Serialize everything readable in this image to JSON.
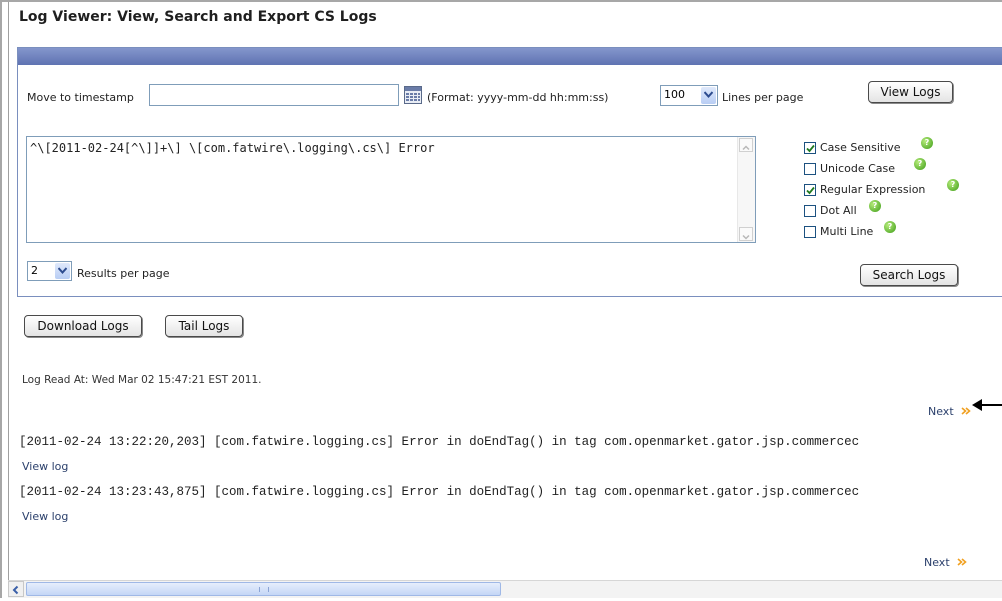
{
  "page": {
    "title": "Log Viewer: View, Search and Export CS Logs"
  },
  "timestamp": {
    "label": "Move to timestamp",
    "value": "",
    "format_hint": "(Format: yyyy-mm-dd hh:mm:ss)"
  },
  "lines_per_page": {
    "value": "100",
    "label": "Lines per page"
  },
  "view_logs_button": "View Logs",
  "search": {
    "query": "^\\[2011-02-24[^\\]]+\\] \\[com.fatwire\\.logging\\.cs\\] Error",
    "options": [
      {
        "label": "Case Sensitive",
        "checked": true
      },
      {
        "label": "Unicode Case",
        "checked": false
      },
      {
        "label": "Regular Expression",
        "checked": true
      },
      {
        "label": "Dot All",
        "checked": false
      },
      {
        "label": "Multi Line",
        "checked": false
      }
    ],
    "results_per_page": "2",
    "results_label": "Results per page",
    "search_button": "Search Logs"
  },
  "actions": {
    "download_button": "Download Logs",
    "tail_button": "Tail Logs"
  },
  "log_read_at": "Log Read At: Wed Mar 02 15:47:21 EST 2011.",
  "pagination": {
    "next_label": "Next"
  },
  "results": [
    {
      "line": "[2011-02-24 13:22:20,203] [com.fatwire.logging.cs] Error in doEndTag() in tag com.openmarket.gator.jsp.commercec",
      "view_link": "View log"
    },
    {
      "line": "[2011-02-24 13:23:43,875] [com.fatwire.logging.cs] Error in doEndTag() in tag com.openmarket.gator.jsp.commercec",
      "view_link": "View log"
    }
  ],
  "colors": {
    "panel_header": "#6f82bf",
    "link": "#2a3f6b",
    "help_icon": "#4caf1e",
    "next_arrow": "#f0a020"
  }
}
